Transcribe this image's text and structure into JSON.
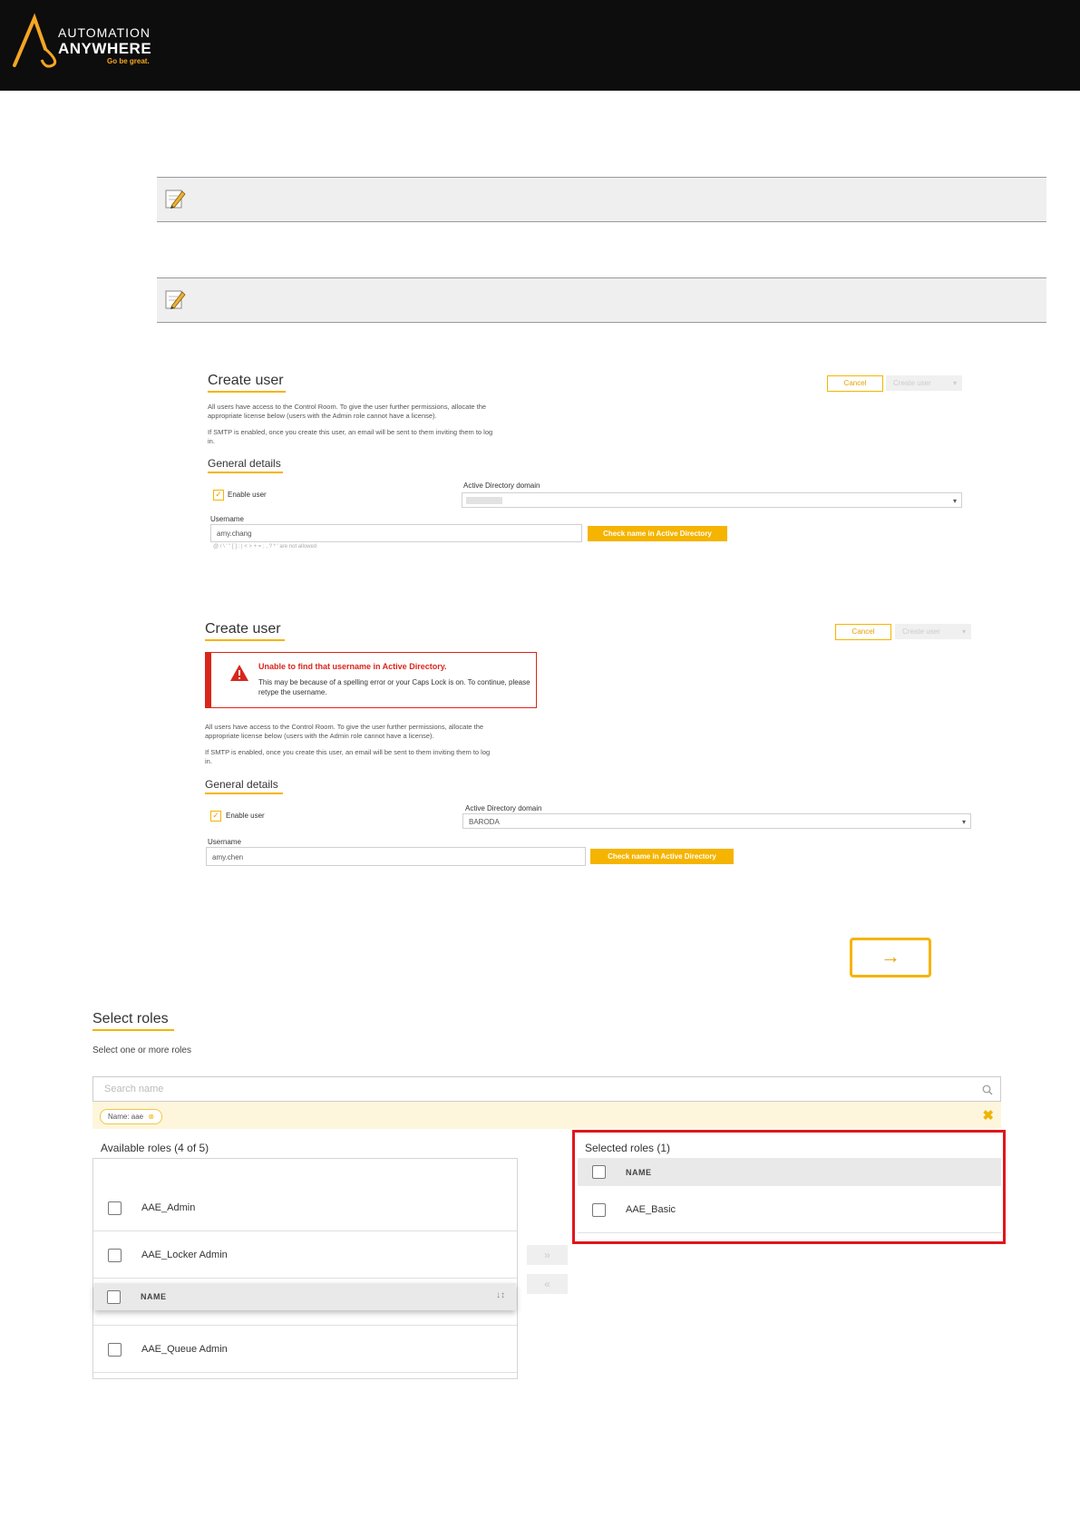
{
  "header": {
    "logo_line1": "AUTOMATION",
    "logo_line2": "ANYWHERE",
    "logo_tagline": "Go be great."
  },
  "create_user_1": {
    "title": "Create user",
    "cancel_label": "Cancel",
    "create_label": "Create user",
    "desc1": "All users have access to the Control Room. To give the user further permissions, allocate the appropriate license below (users with the Admin role cannot have a license).",
    "desc2": "If SMTP is enabled, once you create this user, an email will be sent to them inviting them to log in.",
    "section_title": "General details",
    "enable_user_label": "Enable user",
    "ad_domain_label": "Active Directory domain",
    "username_label": "Username",
    "username_value": "amy.chang",
    "check_button": "Check name in Active Directory",
    "hint": "@ / \\ ' \" [ ] : | < > + = ; , ? * ' are not allowed"
  },
  "create_user_2": {
    "title": "Create user",
    "cancel_label": "Cancel",
    "create_label": "Create user",
    "alert_title": "Unable to find that username in Active Directory.",
    "alert_body": "This may be because of a spelling error or your Caps Lock is on. To continue, please retype the username.",
    "desc1": "All users have access to the Control Room. To give the user further permissions, allocate the appropriate license below (users with the Admin role cannot have a license).",
    "desc2": "If SMTP is enabled, once you create this user, an email will be sent to them inviting them to log in.",
    "section_title": "General details",
    "enable_user_label": "Enable user",
    "ad_domain_label": "Active Directory domain",
    "ad_domain_value": "BARODA",
    "username_label": "Username",
    "username_value": "amy.chen",
    "check_button": "Check name in Active Directory"
  },
  "next_arrow": "→",
  "select_roles": {
    "title": "Select roles",
    "subtitle": "Select one or more roles",
    "search_placeholder": "Search name",
    "filter_chip": "Name: aae",
    "available_title": "Available roles (4 of 5)",
    "available_rows": [
      "AAE_Admin",
      "AAE_Locker Admin",
      "AAE_Queue Admin"
    ],
    "name_header": "NAME",
    "sort_icon_text": "↓↕",
    "selected_title": "Selected roles (1)",
    "selected_rows": [
      "AAE_Basic"
    ],
    "move_right": "»",
    "move_left": "«"
  }
}
